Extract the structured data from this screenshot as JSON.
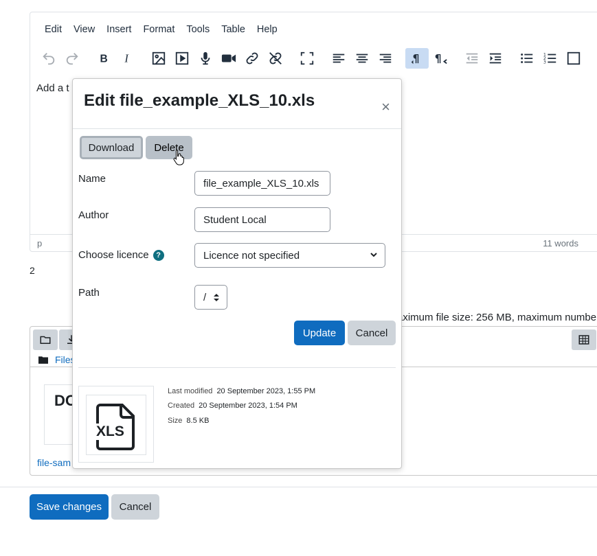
{
  "menu": [
    "Edit",
    "View",
    "Insert",
    "Format",
    "Tools",
    "Table",
    "Help"
  ],
  "editor": {
    "content_text": "Add a t",
    "status_path": "p",
    "word_count": "11 words"
  },
  "below_editor_number": "2",
  "filemanager": {
    "max_info": "aximum file size: 256 MB, maximum numbe",
    "path_label": "Files",
    "thumb_text": "DO",
    "file_name": "file-sam"
  },
  "dialog": {
    "title": "Edit file_example_XLS_10.xls",
    "close": "×",
    "download_label": "Download",
    "delete_label": "Delete",
    "name_label": "Name",
    "name_value": "file_example_XLS_10.xls",
    "author_label": "Author",
    "author_value": "Student Local",
    "licence_label": "Choose licence",
    "licence_value": "Licence not specified",
    "path_label": "Path",
    "path_value": "/",
    "update_label": "Update",
    "cancel_label": "Cancel",
    "preview_text": "XLS",
    "last_modified_label": "Last modified",
    "last_modified_value": "20 September 2023, 1:55 PM",
    "created_label": "Created",
    "created_value": "20 September 2023, 1:54 PM",
    "size_label": "Size",
    "size_value": "8.5 KB"
  },
  "footer": {
    "save_label": "Save changes",
    "cancel_label": "Cancel"
  },
  "colors": {
    "primary": "#0f6cbf",
    "secondary": "#ced4da",
    "help": "#0f6f80"
  }
}
